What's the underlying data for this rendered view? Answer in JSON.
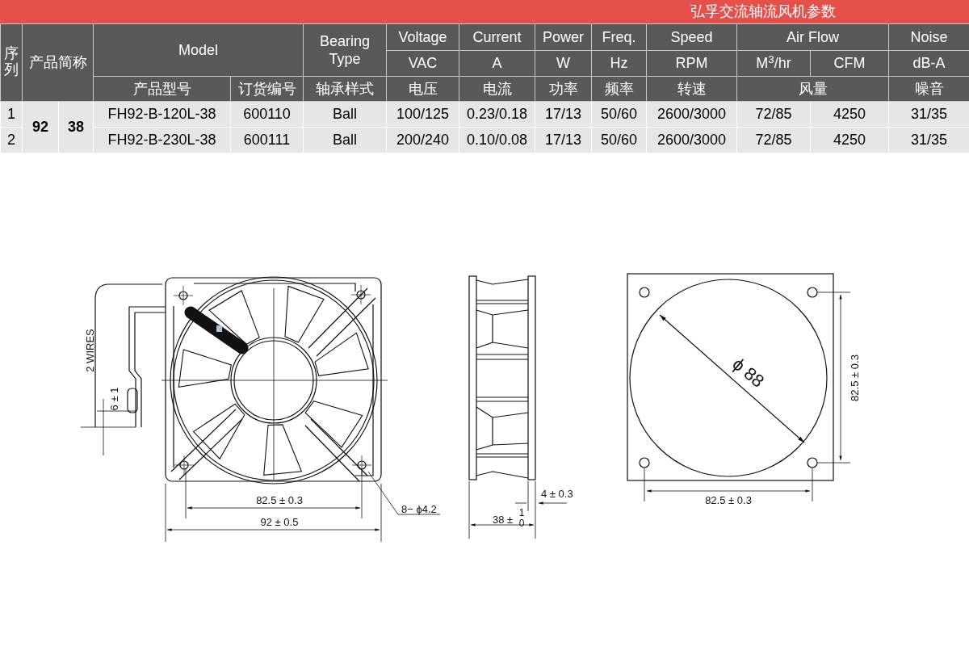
{
  "title": "弘孚交流轴流风机参数",
  "header": {
    "row_1": [
      "序列",
      "产品简称",
      "Model",
      "Bearing Type",
      "Voltage",
      "Current",
      "Power",
      "Freq.",
      "Speed",
      "Air Flow",
      "Noise"
    ],
    "row_2": [
      "VAC",
      "A",
      "W",
      "Hz",
      "RPM",
      "M$^{3}$/hr",
      "CFM",
      "dB-A"
    ],
    "row_3": [
      "产品型号",
      "订货编号",
      "轴承样式",
      "电压",
      "电流",
      "功率",
      "频率",
      "转速",
      "风量",
      "噪音"
    ]
  },
  "size": {
    "frame": "92",
    "thickness": "38"
  },
  "rows": [
    {
      "index": "1",
      "model": "FH92-B-120L-38",
      "order_no": "600110",
      "bearing": "Ball",
      "voltage": "100/125",
      "current": "0.23/0.18",
      "power": "17/13",
      "freq": "50/60",
      "speed": "2600/3000",
      "airflow_m3": "72/85",
      "airflow_cfm": "4250",
      "noise": "31/35"
    },
    {
      "index": "2",
      "model": "FH92-B-230L-38",
      "order_no": "600111",
      "bearing": "Ball",
      "voltage": "200/240",
      "current": "0.10/0.08",
      "power": "17/13",
      "freq": "50/60",
      "speed": "2600/3000",
      "airflow_m3": "72/85",
      "airflow_cfm": "4250",
      "noise": "31/35"
    }
  ],
  "drawings": {
    "front_view": {
      "wires": "2 WIRES",
      "strip": "6 ± 1",
      "hole_pitch": "82.5 ± 0.3",
      "frame_size": "92 ± 0.5",
      "holes": "8− ϕ4.2"
    },
    "side_view": {
      "flange": "4 ± 0.3",
      "depth": "38 ±",
      "depth_upper": "1",
      "depth_lower": "0"
    },
    "back_view": {
      "diameter": "ϕ 88",
      "vertical_pitch": "82.5 ± 0.3",
      "horizontal_pitch": "82.5 ± 0.3"
    }
  }
}
